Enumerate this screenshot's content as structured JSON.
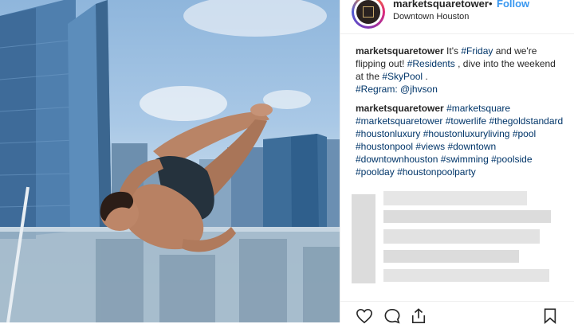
{
  "header": {
    "username": "marketsquaretower",
    "separator": "•",
    "follow_label": "Follow",
    "location": "Downtown Houston"
  },
  "caption": {
    "author": "marketsquaretower",
    "segments": [
      {
        "type": "text",
        "value": " It's "
      },
      {
        "type": "tag",
        "value": "#Friday"
      },
      {
        "type": "text",
        "value": " and we're flipping out! "
      },
      {
        "type": "tag",
        "value": "#Residents"
      },
      {
        "type": "text",
        "value": ", dive into the weekend at the "
      },
      {
        "type": "tag",
        "value": "#SkyPool"
      },
      {
        "type": "text",
        "value": "."
      }
    ],
    "regram_label": "#Regram:",
    "regram_user": "@jhvson"
  },
  "comment": {
    "author": "marketsquaretower",
    "hashtags": [
      "#marketsquare",
      "#marketsquaretower",
      "#towerlife",
      "#thegoldstandard",
      "#houstonluxury",
      "#houstonluxuryliving",
      "#pool",
      "#houstonpool",
      "#views",
      "#downtown",
      "#downtownhouston",
      "#swimming",
      "#poolside",
      "#poolday",
      "#houstonpoolparty"
    ]
  },
  "icons": {
    "like": "heart-icon",
    "comment": "comment-icon",
    "share": "share-icon",
    "save": "bookmark-icon"
  },
  "colors": {
    "link": "#003569",
    "follow": "#3897f0",
    "text": "#262626"
  }
}
